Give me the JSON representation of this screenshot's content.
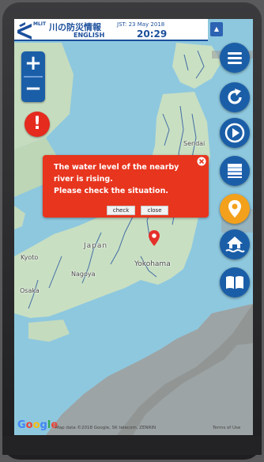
{
  "header": {
    "logo_text": "MLIT",
    "app_title": "川の防災情報",
    "language_link": "ENGLISH",
    "date": "JST: 23 May 2018",
    "time": "20:29",
    "collapse_icon": "triangle-up-icon"
  },
  "zoom": {
    "in_label": "+",
    "out_label": "−"
  },
  "alert_button": {
    "label": "!",
    "color": "#e52a1e"
  },
  "right_buttons": [
    {
      "name": "menu-button",
      "icon": "hamburger-icon"
    },
    {
      "name": "refresh-button",
      "icon": "refresh-icon"
    },
    {
      "name": "play-button",
      "icon": "play-icon"
    },
    {
      "name": "layers-button",
      "icon": "layers-icon"
    },
    {
      "name": "location-button",
      "icon": "location-pin-icon",
      "color": "#f3a11c"
    },
    {
      "name": "shelter-button",
      "icon": "house-flood-icon"
    },
    {
      "name": "guide-button",
      "icon": "book-icon"
    }
  ],
  "dialog": {
    "message": "The water level of the nearby\nriver is rising.\nPlease check the situation.",
    "check_label": "check",
    "close_label": "close",
    "color": "#e8351e"
  },
  "map_labels": {
    "japan": "Japan",
    "kyoto": "Kyoto",
    "nagoya": "Nagoya",
    "osaka": "Osaka",
    "yokohama": "Yokohama",
    "sendai": "Sendai"
  },
  "footer": {
    "google": "Google",
    "attribution": "Map data ©2018 Google, SK telecom, ZENRIN",
    "terms": "Terms of Use"
  },
  "colors": {
    "brand_blue": "#1b5ea8",
    "sea": "#8ec8df",
    "land": "#c8dfc2"
  }
}
